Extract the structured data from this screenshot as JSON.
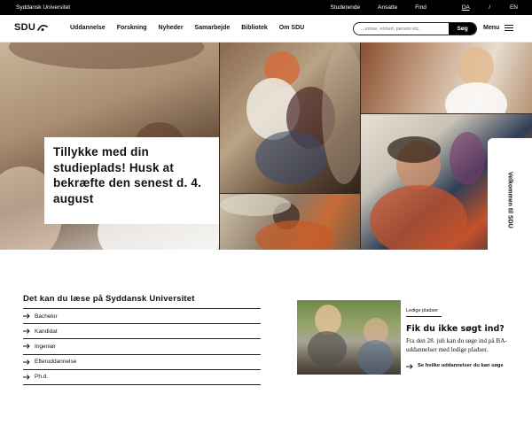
{
  "topbar": {
    "brand": "Syddansk Universitet",
    "links": [
      "Studerende",
      "Ansatte",
      "Find"
    ],
    "lang_da": "DA",
    "lang_sep": "/",
    "lang_en": "EN"
  },
  "nav": {
    "logo": "SDU",
    "items": [
      "Uddannelse",
      "Forskning",
      "Nyheder",
      "Samarbejde",
      "Bibliotek",
      "Om SDU"
    ],
    "search_placeholder": "...emne, enhed, person etc.",
    "search_button": "Søg",
    "menu_label": "Menu"
  },
  "hero": {
    "headline": "Tillykke med din studieplads! Husk at bekræfte den senest d. 4. august",
    "side_tab": "Velkommen til SDU"
  },
  "study": {
    "title": "Det kan du læse på Syddansk Universitet",
    "items": [
      "Bachelor",
      "Kandidat",
      "Ingeniør",
      "Efteruddannelse",
      "Ph.d."
    ]
  },
  "teaser": {
    "label": "Ledige pladser",
    "title": "Fik du ikke søgt ind?",
    "body": "Fra den 28. juli kan du søge ind på BA-uddannelser med ledige pladser.",
    "link": "Se hvilke uddannelser du kan søge"
  },
  "icons": {
    "arrow": "arrow-right-icon",
    "logo_mark": "sdu-logo-icon",
    "menu": "hamburger-icon"
  }
}
